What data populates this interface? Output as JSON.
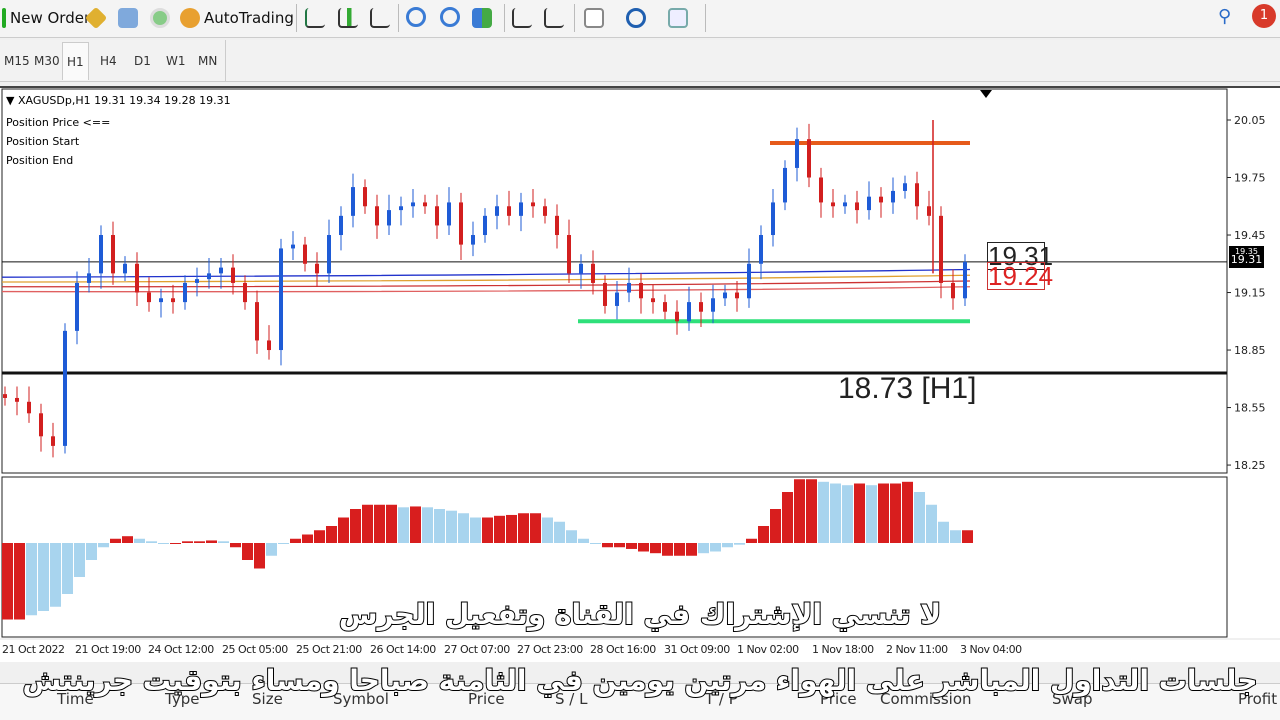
{
  "toolbar": {
    "new_order": "New Order",
    "autotrading": "AutoTrading",
    "icons": [
      "new-order-icon",
      "metaeditor-icon",
      "navigator-icon",
      "signal-icon",
      "autotrading-icon",
      "bar-chart-icon",
      "candlestick-icon",
      "line-chart-icon",
      "zoom-in-icon",
      "zoom-out-icon",
      "tile-windows-icon",
      "chart-shift-icon",
      "autoscroll-icon",
      "indicators-icon",
      "periods-icon",
      "templates-icon",
      "search-icon",
      "notification-icon"
    ],
    "notification_count": "1"
  },
  "timeframes": [
    "M15",
    "M30",
    "H1",
    "H4",
    "D1",
    "W1",
    "MN"
  ],
  "active_timeframe": "H1",
  "chart": {
    "header": "XAGUSDp,H1  19.31 19.34 19.28 19.31",
    "objects": [
      "Position Price <==",
      "Position Start",
      "Position End"
    ],
    "level_label": "18.73 [H1]",
    "price_box_1": "19.31",
    "price_box_2": "19.24",
    "current_price": "19.31",
    "hidden_price": "19.35",
    "price_ticks": [
      "20.05",
      "19.75",
      "19.45",
      "19.15",
      "18.85",
      "18.55",
      "18.25"
    ],
    "time_ticks": [
      "21 Oct 2022",
      "21 Oct 19:00",
      "24 Oct 12:00",
      "25 Oct 05:00",
      "25 Oct 21:00",
      "26 Oct 14:00",
      "27 Oct 07:00",
      "27 Oct 23:00",
      "28 Oct 16:00",
      "31 Oct 09:00",
      "1 Nov 02:00",
      "1 Nov 18:00",
      "2 Nov 11:00",
      "3 Nov 04:00"
    ],
    "colors": {
      "bull": "#1e5bd6",
      "bear": "#d21f1f",
      "resistance": "#e65a1a",
      "support": "#2ee07a",
      "hist_red": "#d81e1e",
      "hist_blue": "#a8d4ee"
    }
  },
  "chart_data": {
    "type": "candlestick",
    "symbol": "XAGUSDp",
    "timeframe": "H1",
    "ylim": [
      18.2,
      20.15
    ],
    "closes": [
      18.6,
      18.58,
      18.52,
      18.4,
      18.35,
      18.95,
      19.2,
      19.25,
      19.45,
      19.25,
      19.3,
      19.15,
      19.1,
      19.12,
      19.1,
      19.2,
      19.22,
      19.25,
      19.28,
      19.2,
      19.1,
      18.9,
      18.85,
      19.38,
      19.4,
      19.3,
      19.25,
      19.45,
      19.55,
      19.7,
      19.6,
      19.5,
      19.58,
      19.6,
      19.62,
      19.6,
      19.5,
      19.62,
      19.4,
      19.45,
      19.55,
      19.6,
      19.55,
      19.62,
      19.6,
      19.55,
      19.45,
      19.25,
      19.3,
      19.2,
      19.08,
      19.15,
      19.2,
      19.12,
      19.1,
      19.05,
      19.0,
      19.1,
      19.05,
      19.12,
      19.15,
      19.12,
      19.3,
      19.45,
      19.62,
      19.8,
      19.95,
      19.75,
      19.62,
      19.6,
      19.62,
      19.58,
      19.65,
      19.62,
      19.68,
      19.72,
      19.6,
      19.55,
      19.2,
      19.12,
      19.31
    ],
    "levels": {
      "resistance": 19.93,
      "support": 19.0,
      "h1_level": 18.73,
      "current": 19.31
    },
    "moving_averages": [
      19.27,
      19.24,
      19.21,
      19.18
    ],
    "oscillator": [
      -0.9,
      -0.9,
      -0.85,
      -0.8,
      -0.75,
      -0.6,
      -0.4,
      -0.2,
      -0.05,
      0.05,
      0.08,
      0.05,
      0.02,
      0,
      0,
      0.02,
      0.02,
      0.03,
      0.02,
      -0.05,
      -0.2,
      -0.3,
      -0.15,
      0,
      0.05,
      0.1,
      0.15,
      0.2,
      0.3,
      0.4,
      0.45,
      0.45,
      0.45,
      0.42,
      0.43,
      0.42,
      0.4,
      0.38,
      0.35,
      0.3,
      0.3,
      0.32,
      0.33,
      0.35,
      0.35,
      0.3,
      0.25,
      0.15,
      0.05,
      0,
      -0.05,
      -0.05,
      -0.07,
      -0.1,
      -0.12,
      -0.15,
      -0.15,
      -0.15,
      -0.12,
      -0.1,
      -0.05,
      -0.02,
      0.05,
      0.2,
      0.4,
      0.6,
      0.75,
      0.75,
      0.72,
      0.7,
      0.68,
      0.7,
      0.68,
      0.7,
      0.7,
      0.72,
      0.6,
      0.45,
      0.25,
      0.15,
      0.15
    ]
  },
  "subtitles": {
    "line1": "لا تنسي الإشتراك في القناة وتفعيل الجرس",
    "line2": "جلسات التداول المباشر على الهواء مرتين يومين في الثامنة صباحا ومساء بتوقيت جرينتش"
  },
  "terminal": {
    "columns": [
      "Time",
      "Type",
      "Size",
      "Symbol",
      "Price",
      "S / L",
      "T / P",
      "Price",
      "Commission",
      "Swap",
      "Profit"
    ]
  }
}
